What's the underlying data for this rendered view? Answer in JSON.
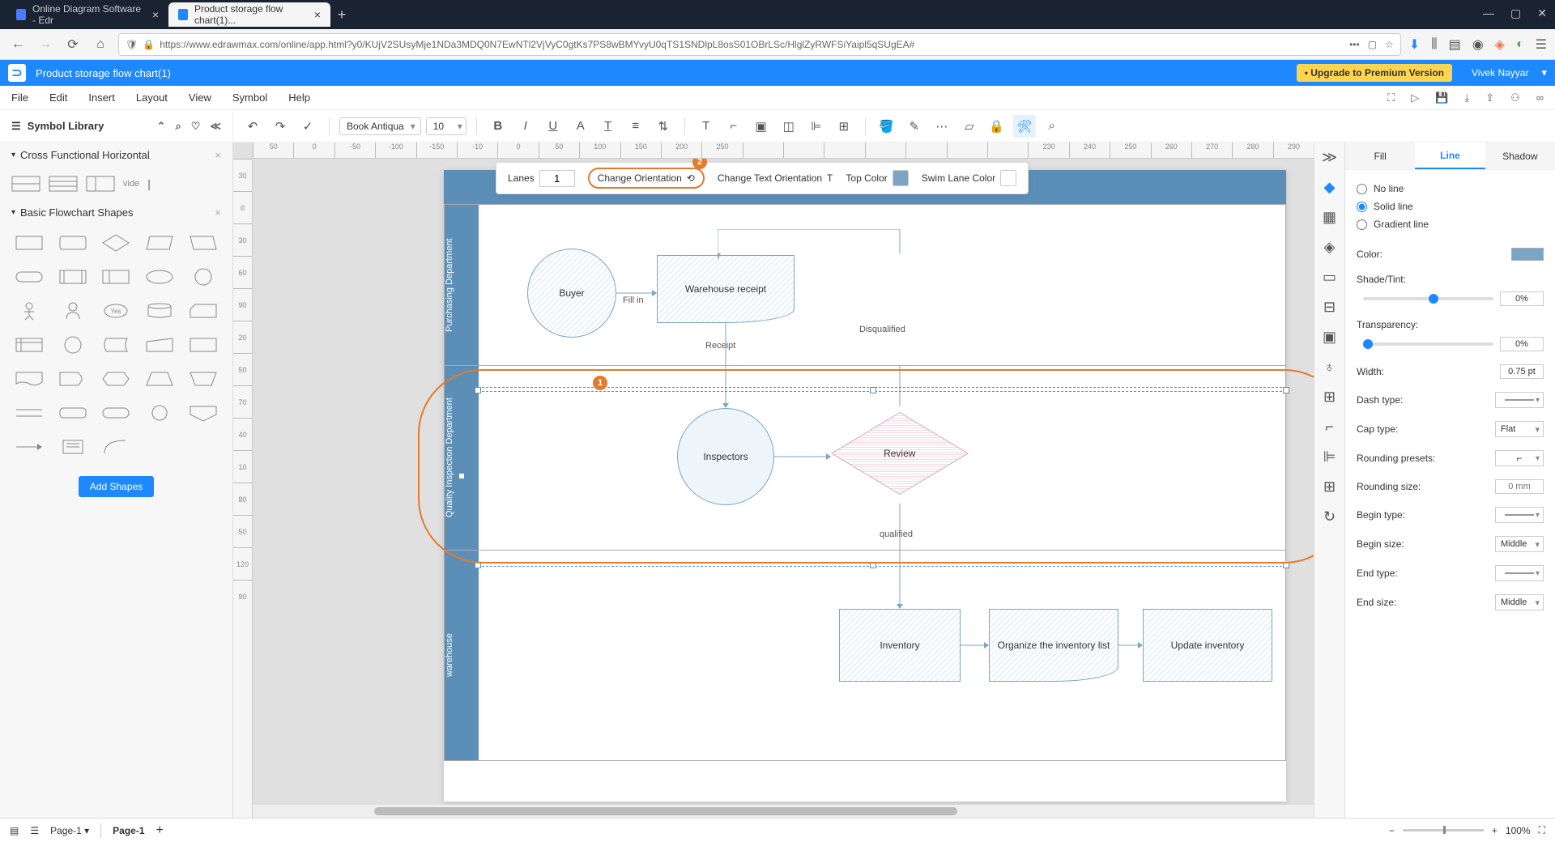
{
  "browser": {
    "tabs": [
      {
        "title": "Online Diagram Software - Edr",
        "active": false
      },
      {
        "title": "Product storage flow chart(1)...",
        "active": true
      }
    ],
    "url": "https://www.edrawmax.com/online/app.html?y0/KUjV2SUsyMje1NDa3MDQ0N7EwNTl2VjVyC0gtKs7PS8wBMYvyU0qTS1SNDlpL8osS01OBrLSc/HlglZyRWFSiYaipl5qSUgEA#"
  },
  "app": {
    "doc_title": "Product storage flow chart(1)",
    "upgrade": "• Upgrade to Premium Version",
    "user": "Vivek Nayyar"
  },
  "menu": {
    "items": [
      "File",
      "Edit",
      "Insert",
      "Layout",
      "View",
      "Symbol",
      "Help"
    ]
  },
  "symbol_library": {
    "title": "Symbol Library"
  },
  "toolbar": {
    "font": "Book Antiqua",
    "font_size": "10"
  },
  "left_panels": {
    "cfh": "Cross Functional Horizontal",
    "cfh_label": "vide",
    "basic": "Basic Flowchart Shapes",
    "add_shapes": "Add Shapes"
  },
  "swimlane_toolbar": {
    "lanes_label": "Lanes",
    "lanes_value": "1",
    "change_orientation": "Change Orientation",
    "change_text_orientation": "Change Text Orientation",
    "top_color": "Top Color",
    "swim_lane_color": "Swim Lane Color",
    "badge_2": "2",
    "badge_1": "1"
  },
  "diagram": {
    "title": "Product storage flow chart",
    "lanes": [
      {
        "label": "Purchasing Department"
      },
      {
        "label": "Quality Inspection Department"
      },
      {
        "label": "warehouse"
      }
    ],
    "shapes": {
      "buyer": "Buyer",
      "warehouse_receipt": "Warehouse receipt",
      "inspectors": "Inspectors",
      "review": "Review",
      "inventory": "Inventory",
      "organize": "Organize the inventory list",
      "update": "Update inventory"
    },
    "labels": {
      "fill_in": "Fill in",
      "receipt": "Receipt",
      "disqualified": "Disqualified",
      "qualified": "qualified"
    }
  },
  "ruler_h": [
    "50",
    "0",
    "-50",
    "-100",
    "-150",
    "-10",
    "0",
    "50",
    "100",
    "150",
    "200",
    "250",
    "",
    "",
    "",
    "",
    "",
    "",
    "",
    "230",
    "240",
    "250",
    "260",
    "270",
    "280",
    "290"
  ],
  "ruler_v": [
    "30",
    "0",
    "30",
    "60",
    "90",
    "20",
    "50",
    "70",
    "40",
    "10",
    "80",
    "50",
    "120",
    "90"
  ],
  "right_panel": {
    "tabs": [
      "Fill",
      "Line",
      "Shadow"
    ],
    "active_tab": 1,
    "line_type": {
      "no_line": "No line",
      "solid": "Solid line",
      "gradient": "Gradient line"
    },
    "props": {
      "color": "Color:",
      "shade": "Shade/Tint:",
      "shade_val": "0%",
      "transparency": "Transparency:",
      "trans_val": "0%",
      "width": "Width:",
      "width_val": "0.75 pt",
      "dash": "Dash type:",
      "cap": "Cap type:",
      "cap_val": "Flat",
      "rounding_presets": "Rounding presets:",
      "rounding_size": "Rounding size:",
      "rounding_size_ph": "0 mm",
      "begin_type": "Begin type:",
      "begin_size": "Begin size:",
      "begin_size_val": "Middle",
      "end_type": "End type:",
      "end_size": "End size:",
      "end_size_val": "Middle"
    }
  },
  "status": {
    "page_tab": "Page-1",
    "page_label": "Page-1",
    "zoom": "100%"
  }
}
